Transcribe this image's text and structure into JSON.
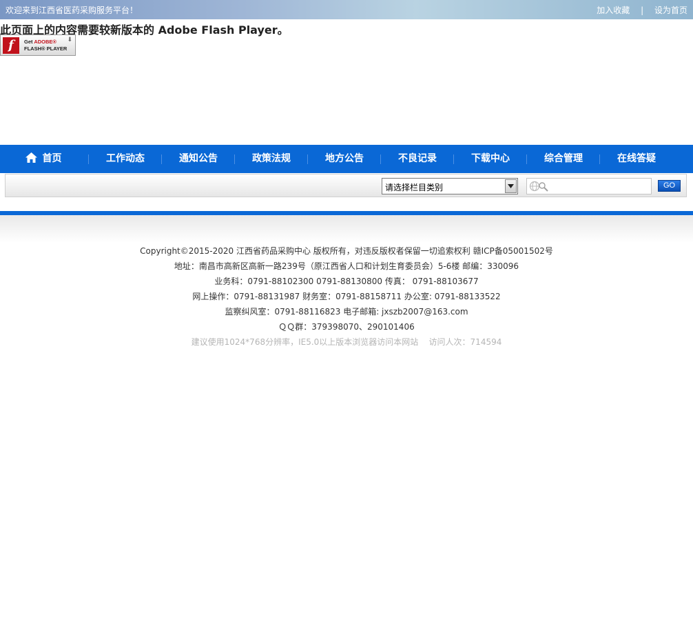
{
  "topbar": {
    "welcome": "欢迎来到江西省医药采购服务平台！",
    "add_favorite": "加入收藏",
    "separator": "|",
    "set_homepage": "设为首页"
  },
  "flash": {
    "message": "此页面上的内容需要较新版本的 Adobe Flash Player。",
    "button_line1_a": "Get ",
    "button_line1_b": "ADOBE®",
    "button_line2": "FLASH® PLAYER"
  },
  "nav": {
    "items": [
      {
        "label": "首页"
      },
      {
        "label": "工作动态"
      },
      {
        "label": "通知公告"
      },
      {
        "label": "政策法规"
      },
      {
        "label": "地方公告"
      },
      {
        "label": "不良记录"
      },
      {
        "label": "下载中心"
      },
      {
        "label": "综合管理"
      },
      {
        "label": "在线答疑"
      }
    ]
  },
  "search": {
    "category_selected": "请选择栏目类别",
    "keyword_value": "",
    "go_label": "GO"
  },
  "footer": {
    "line1": "Copyright©2015-2020 江西省药品采购中心 版权所有，对违反版权者保留一切追索权利 赣ICP备05001502号",
    "line2": "地址：南昌市高新区高新一路239号（原江西省人口和计划生育委员会）5-6楼 邮编：330096",
    "line3": "业务科：0791-88102300 0791-88130800 传真： 0791-88103677",
    "line4": "网上操作：0791-88131987  财务室：0791-88158711 办公室: 0791-88133522",
    "line5": "监察纠风室：0791-88116823 电子邮箱: jxszb2007@163.com",
    "line6": "ＱＱ群：379398070、290101406",
    "line7": "建议使用1024*768分辨率，IE5.0以上版本浏览器访问本网站    访问人次：714594"
  }
}
